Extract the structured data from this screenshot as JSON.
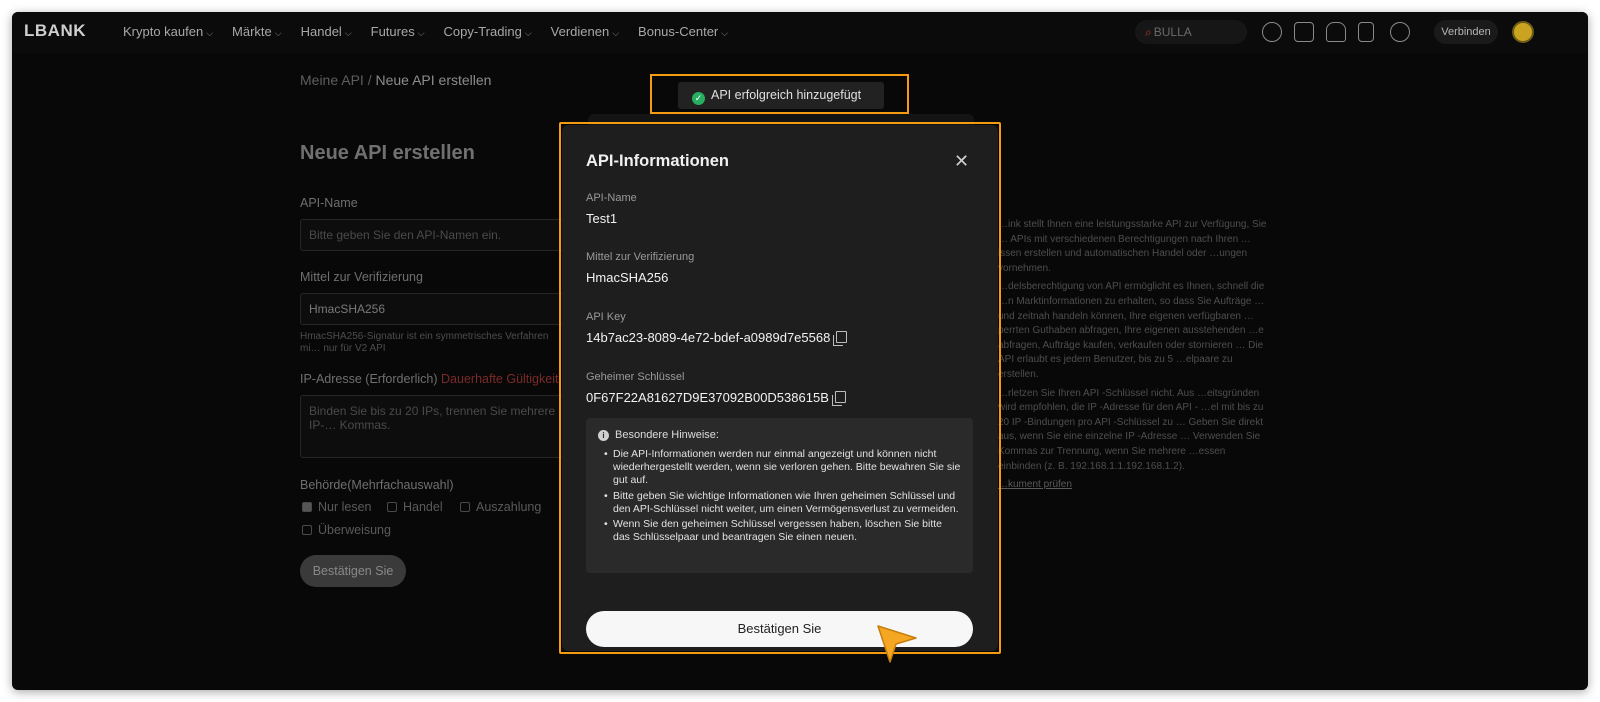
{
  "header": {
    "logo": "LBANK",
    "nav": [
      "Krypto kaufen",
      "Märkte",
      "Handel",
      "Futures",
      "Copy-Trading",
      "Verdienen",
      "Bonus-Center"
    ],
    "search_placeholder": "BULLA",
    "connect_label": "Verbinden"
  },
  "breadcrumb": {
    "parent": "Meine API",
    "separator": "/",
    "current": "Neue API erstellen"
  },
  "form": {
    "title": "Neue API erstellen",
    "api_name_label": "API-Name",
    "api_name_placeholder": "Bitte geben Sie den API-Namen ein.",
    "verification_label": "Mittel zur Verifizierung",
    "verification_value": "HmacSHA256",
    "verification_hint": "HmacSHA256-Signatur ist ein symmetrisches Verfahren mi… nur für V2 API",
    "ip_label": "IP-Adresse (Erforderlich)",
    "ip_badge": "Dauerhafte Gültigkeit",
    "ip_placeholder": "Binden Sie bis zu 20 IPs, trennen Sie mehrere IP-… Kommas.",
    "permissions_label": "Behörde(Mehrfachauswahl)",
    "permissions": [
      "Nur lesen",
      "Handel",
      "Auszahlung",
      "Überweisung"
    ],
    "confirm_label": "Bestätigen Sie"
  },
  "side_info": {
    "p1": "…ink stellt Ihnen eine leistungsstarke API zur Verfügung, Sie … APIs mit verschiedenen Berechtigungen nach Ihren …issen erstellen und automatischen Handel oder …ungen vornehmen.",
    "p2": "…delsberechtigung von API ermöglicht es Ihnen, schnell die …n Marktinformationen zu erhalten, so dass Sie Aufträge … und zeitnah handeln können, Ihre eigenen verfügbaren …perrten Guthaben abfragen, Ihre eigenen ausstehenden …e abfragen, Aufträge kaufen, verkaufen oder stornieren … Die API erlaubt es jedem Benutzer, bis zu 5 …elpaare zu erstellen.",
    "p3": "…rletzen Sie Ihren API -Schlüssel nicht. Aus …eitsgründen wird empfohlen, die IP -Adresse für den API - …el mit bis zu 20 IP -Bindungen pro API -Schlüssel zu … Geben Sie direkt aus, wenn Sie eine einzelne IP -Adresse … Verwenden Sie Kommas zur Trennung, wenn Sie mehrere …essen einbinden (z. B. 192.168.1.1.192.168.1.2).",
    "link": "…kument prüfen"
  },
  "toast": {
    "message": "API erfolgreich hinzugefügt"
  },
  "modal": {
    "title": "API-Informationen",
    "api_name_label": "API-Name",
    "api_name_value": "Test1",
    "verification_label": "Mittel zur Verifizierung",
    "verification_value": "HmacSHA256",
    "api_key_label": "API Key",
    "api_key_value": "14b7ac23-8089-4e72-bdef-a0989d7e5568",
    "secret_label": "Geheimer Schlüssel",
    "secret_value": "0F67F22A81627D9E37092B00D538615B",
    "notice_title": "Besondere Hinweise:",
    "notices": [
      "Die API-Informationen werden nur einmal angezeigt und können nicht wiederhergestellt werden, wenn sie verloren gehen. Bitte bewahren Sie sie gut auf.",
      "Bitte geben Sie wichtige Informationen wie Ihren geheimen Schlüssel und den API-Schlüssel nicht weiter, um einen Vermögensverlust zu vermeiden.",
      "Wenn Sie den geheimen Schlüssel vergessen haben, löschen Sie bitte das Schlüsselpaar und beantragen Sie einen neuen."
    ],
    "confirm_label": "Bestätigen Sie"
  },
  "colors": {
    "highlight": "#f39c12",
    "success": "#27ae60",
    "accent_red": "#7a2a2a"
  },
  "icons": [
    "download-icon",
    "wallet-icon",
    "bell-icon",
    "document-icon",
    "globe-icon",
    "copy-icon",
    "close-icon",
    "info-icon",
    "check-circle-icon",
    "cursor-arrow-icon"
  ]
}
